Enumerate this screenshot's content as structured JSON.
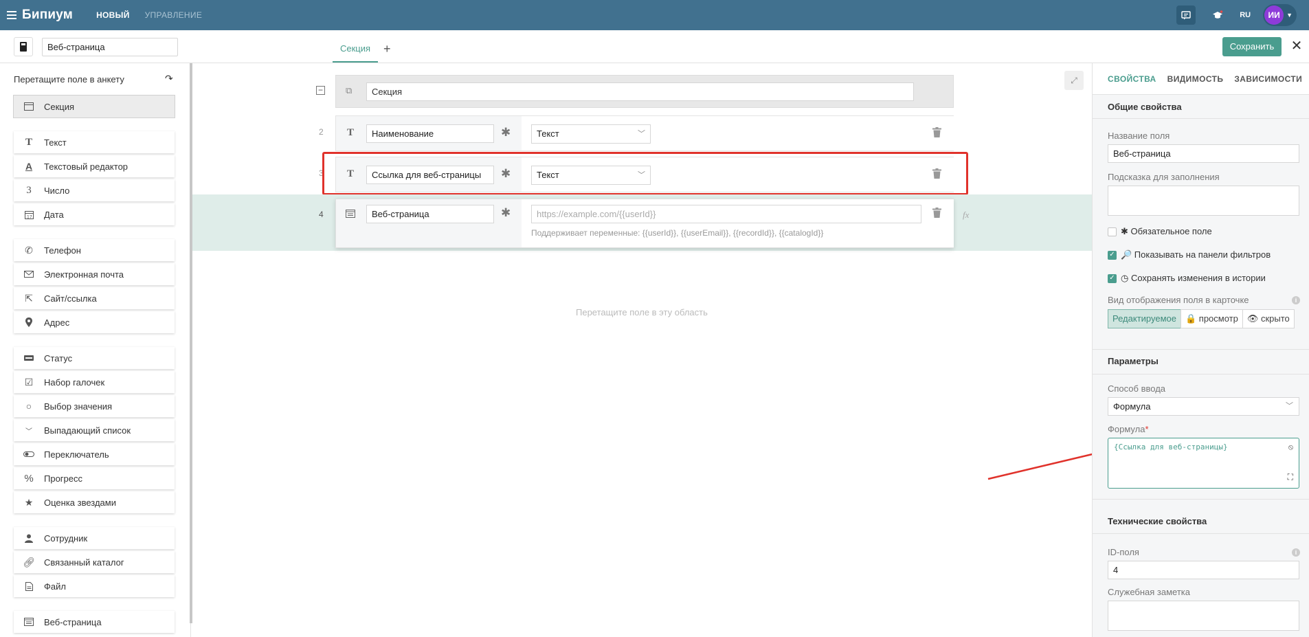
{
  "app": {
    "brand": "Бипиум",
    "nav": [
      {
        "label": "НОВЫЙ",
        "active": true
      },
      {
        "label": "УПРАВЛЕНИЕ",
        "active": false
      }
    ],
    "lang": "RU",
    "avatar_initials": "ИИ",
    "colors": {
      "topbar": "#41718f",
      "accent": "#4a9d8e",
      "avatar": "#8e3bd9",
      "annotation": "#e0322b"
    }
  },
  "header": {
    "catalog_name": "Веб-страница",
    "tabs": [
      {
        "label": "Секция"
      }
    ],
    "add_tab": "+",
    "save_label": "Сохранить"
  },
  "sidebar": {
    "title": "Перетащите поле в анкету",
    "groups": [
      [
        {
          "label": "Секция",
          "icon": "section-icon"
        }
      ],
      [
        {
          "label": "Текст",
          "icon": "text-icon"
        },
        {
          "label": "Текстовый редактор",
          "icon": "text-editor-icon"
        },
        {
          "label": "Число",
          "icon": "number-icon"
        },
        {
          "label": "Дата",
          "icon": "calendar-icon"
        }
      ],
      [
        {
          "label": "Телефон",
          "icon": "phone-icon"
        },
        {
          "label": "Электронная почта",
          "icon": "mail-icon"
        },
        {
          "label": "Сайт/ссылка",
          "icon": "link-out-icon"
        },
        {
          "label": "Адрес",
          "icon": "pin-icon"
        }
      ],
      [
        {
          "label": "Статус",
          "icon": "status-icon"
        },
        {
          "label": "Набор галочек",
          "icon": "checkbox-icon"
        },
        {
          "label": "Выбор значения",
          "icon": "radio-icon"
        },
        {
          "label": "Выпадающий список",
          "icon": "chevron-down-icon"
        },
        {
          "label": "Переключатель",
          "icon": "toggle-icon"
        },
        {
          "label": "Прогресс",
          "icon": "percent-icon"
        },
        {
          "label": "Оценка звездами",
          "icon": "star-icon"
        }
      ],
      [
        {
          "label": "Сотрудник",
          "icon": "user-icon"
        },
        {
          "label": "Связанный каталог",
          "icon": "chain-icon"
        },
        {
          "label": "Файл",
          "icon": "file-icon"
        }
      ],
      [
        {
          "label": "Веб-страница",
          "icon": "webpage-icon"
        }
      ]
    ]
  },
  "canvas": {
    "section_name": "Секция",
    "fields": [
      {
        "num": "2",
        "name": "Наименование",
        "type": "Текст"
      },
      {
        "num": "3",
        "name": "Ссылка для веб-страницы",
        "type": "Текст"
      }
    ],
    "web_field": {
      "num": "4",
      "name": "Веб-страница",
      "url_placeholder": "https://example.com/{{userId}}",
      "hint": "Поддерживает переменные: {{userId}}, {{userEmail}}, {{recordId}}, {{catalogId}}",
      "fx": "fx"
    },
    "drop_hint": "Перетащите поле в эту область"
  },
  "panel": {
    "tabs": [
      "СВОЙСТВА",
      "ВИДИМОСТЬ",
      "ЗАВИСИМОСТИ"
    ],
    "general": {
      "title": "Общие свойства",
      "name_label": "Название поля",
      "name_value": "Веб-страница",
      "hint_label": "Подсказка для заполнения",
      "hint_value": "",
      "required": {
        "label": "✱ Обязательное поле",
        "checked": false
      },
      "filters": {
        "label": "🔎 Показывать на панели фильтров",
        "checked": true
      },
      "history": {
        "label": "◷ Сохранять изменения в истории",
        "checked": true
      },
      "view_label": "Вид отображения поля в карточке",
      "view_options": [
        "Редактируемое",
        "🔒 просмотр",
        "👁 скрыто"
      ],
      "view_selected": 0
    },
    "params": {
      "title": "Параметры",
      "input_label": "Способ ввода",
      "input_value": "Формула",
      "formula_label": "Формула",
      "formula_required_mark": "*",
      "formula_value": "{Ссылка для веб-страницы}"
    },
    "tech": {
      "title": "Технические свойства",
      "id_label": "ID-поля",
      "id_value": "4",
      "note_label": "Служебная заметка",
      "note_value": ""
    }
  }
}
